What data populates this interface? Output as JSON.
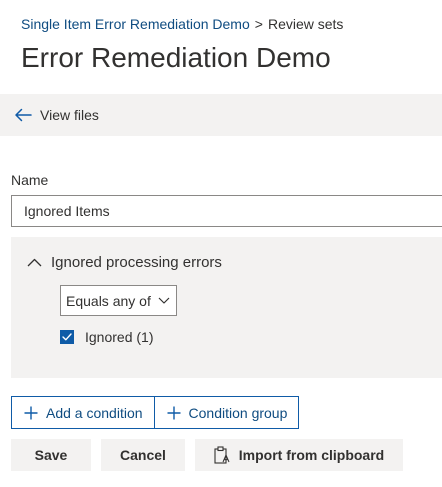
{
  "breadcrumb": {
    "parent": "Single Item Error Remediation Demo",
    "separator": ">",
    "current": "Review sets"
  },
  "page": {
    "title": "Error Remediation Demo"
  },
  "command_bar": {
    "view_files_label": "View files"
  },
  "form": {
    "name_label": "Name",
    "name_value": "Ignored Items"
  },
  "condition_group": {
    "title": "Ignored processing errors",
    "operator": "Equals any of",
    "options": [
      {
        "label": "Ignored (1)",
        "checked": true
      }
    ]
  },
  "actions": {
    "add_condition": "Add a condition",
    "condition_group": "Condition group",
    "save": "Save",
    "cancel": "Cancel",
    "import": "Import from clipboard"
  },
  "icons": {
    "back": "arrow-left-icon",
    "collapse": "chevron-up-icon",
    "dropdown": "chevron-down-icon",
    "check": "checkmark-icon",
    "add": "plus-icon",
    "clipboard": "clipboard-icon"
  },
  "colors": {
    "accent": "#0f5ba7",
    "link": "#0f4c81",
    "panel": "#f3f2f1",
    "text": "#323130"
  }
}
